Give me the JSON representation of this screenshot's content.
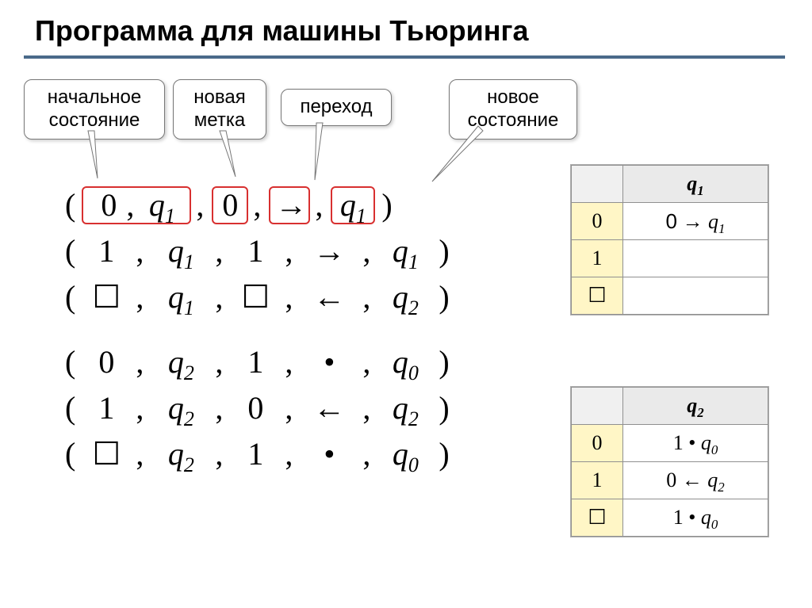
{
  "title": "Программа для машины Тьюринга",
  "callouts": {
    "initial_state": "начальное\nсостояние",
    "new_mark": "новая\nметка",
    "transition": "переход",
    "new_state": "новое\nсостояние"
  },
  "tuples_block1": [
    {
      "sym": "0",
      "state": "q₁",
      "wsym": "0",
      "move": "→",
      "nstate": "q₁",
      "highlight_groups": true
    },
    {
      "sym": "1",
      "state": "q₁",
      "wsym": "1",
      "move": "→",
      "nstate": "q₁"
    },
    {
      "sym": "☐",
      "state": "q₁",
      "wsym": "☐",
      "move": "←",
      "nstate": "q₂"
    }
  ],
  "tuples_block2": [
    {
      "sym": "0",
      "state": "q₂",
      "wsym": "1",
      "move": "•",
      "nstate": "q₀"
    },
    {
      "sym": "1",
      "state": "q₂",
      "wsym": "0",
      "move": "←",
      "nstate": "q₂"
    },
    {
      "sym": "☐",
      "state": "q₂",
      "wsym": "1",
      "move": "•",
      "nstate": "q₀"
    }
  ],
  "table1": {
    "state_header": "q₁",
    "rows": [
      {
        "sym": "0",
        "rule": "0 → q₁"
      },
      {
        "sym": "1",
        "rule": ""
      },
      {
        "sym": "☐",
        "rule": ""
      }
    ]
  },
  "table2": {
    "state_header": "q₂",
    "rows": [
      {
        "sym": "0",
        "rule": "1 • q₀"
      },
      {
        "sym": "1",
        "rule": "0 ← q₂"
      },
      {
        "sym": "☐",
        "rule": "1 • q₀"
      }
    ]
  }
}
